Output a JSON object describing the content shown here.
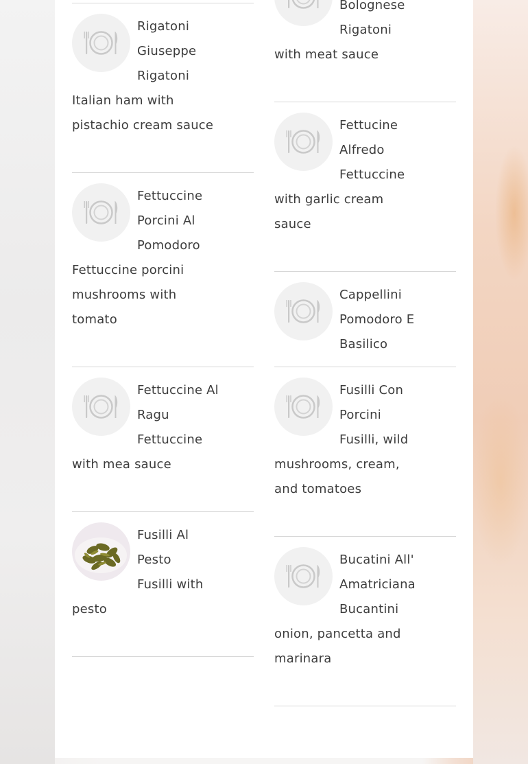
{
  "menu": {
    "left_column": [
      {
        "name": [
          "Rigatoni",
          "Giuseppe"
        ],
        "desc": [
          "Rigatoni",
          "Italian ham with",
          "pistachio cream sauce"
        ],
        "image": "plate-placeholder"
      },
      {
        "name": [
          "Fettuccine",
          "Porcini Al"
        ],
        "desc": [
          "Pomodoro",
          "Fettuccine porcini",
          "mushrooms with",
          "tomato"
        ],
        "image": "plate-placeholder"
      },
      {
        "name": [
          "Fettuccine Al",
          "Ragu"
        ],
        "desc": [
          "Fettuccine",
          "with mea sauce"
        ],
        "image": "plate-placeholder"
      },
      {
        "name": [
          "Fusilli Al",
          "Pesto"
        ],
        "desc": [
          "Fusilli with",
          "pesto"
        ],
        "image": "fusilli-pesto-photo"
      }
    ],
    "right_column": [
      {
        "name": [
          "Bolognese"
        ],
        "desc": [
          "Rigatoni",
          "with meat sauce"
        ],
        "image": "plate-placeholder"
      },
      {
        "name": [
          "Fettucine",
          "Alfredo"
        ],
        "desc": [
          "Fettuccine",
          "with garlic cream",
          "sauce"
        ],
        "image": "plate-placeholder"
      },
      {
        "name": [
          "Cappellini",
          "Pomodoro E"
        ],
        "desc": [
          "Basilico"
        ],
        "image": "plate-placeholder"
      },
      {
        "name": [
          "Fusilli Con",
          "Porcini"
        ],
        "desc": [
          "Fusilli, wild",
          "mushrooms, cream,",
          "and tomatoes"
        ],
        "image": "plate-placeholder"
      },
      {
        "name": [
          "Bucatini All'",
          "Amatriciana"
        ],
        "desc": [
          "Bucantini",
          "onion, pancetta and",
          "marinara"
        ],
        "image": "plate-placeholder"
      }
    ]
  },
  "colors": {
    "text": "#3d3d3d",
    "rule": "#d7d7d7",
    "panel": "#ffffff",
    "thumb_bg": "#f1f1f1"
  }
}
